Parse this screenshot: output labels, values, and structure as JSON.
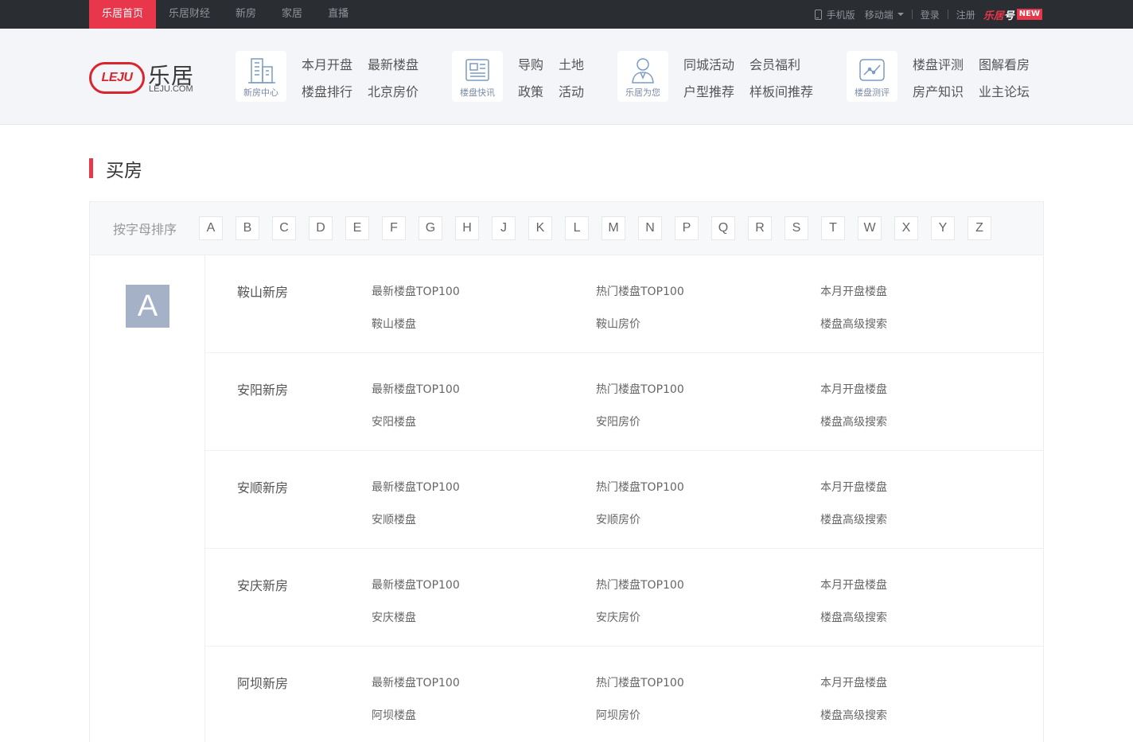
{
  "topnav": {
    "items": [
      "乐居首页",
      "乐居财经",
      "新房",
      "家居",
      "直播"
    ],
    "mobile": "手机版",
    "mobile_end": "移动端",
    "login": "登录",
    "register": "注册",
    "lejuhao_a": "乐居",
    "lejuhao_b": "号",
    "lejuhao_badge": "NEW"
  },
  "logo": {
    "badge": "LEJU",
    "cn": "乐居",
    "en": "LEJU.COM"
  },
  "nav": {
    "g1": {
      "caption": "新房中心",
      "icon": "building-icon",
      "links": [
        "本月开盘",
        "楼盘排行",
        "最新楼盘",
        "北京房价"
      ]
    },
    "g2": {
      "caption": "楼盘快讯",
      "icon": "newspaper-icon",
      "links": [
        "导购",
        "政策",
        "土地",
        "活动"
      ]
    },
    "g3": {
      "caption": "乐居为您",
      "icon": "agent-icon",
      "links": [
        "同城活动",
        "户型推荐",
        "会员福利",
        "样板间推荐"
      ]
    },
    "g4": {
      "caption": "楼盘测评",
      "icon": "chart-icon",
      "links": [
        "楼盘评测",
        "房产知识",
        "图解看房",
        "业主论坛"
      ]
    }
  },
  "section_title": "买房",
  "letters": {
    "label": "按字母排序",
    "items": [
      "A",
      "B",
      "C",
      "D",
      "E",
      "F",
      "G",
      "H",
      "J",
      "K",
      "L",
      "M",
      "N",
      "P",
      "Q",
      "R",
      "S",
      "T",
      "W",
      "X",
      "Y",
      "Z"
    ]
  },
  "current_letter": "A",
  "cities": [
    {
      "name": "鞍山新房",
      "l1": "最新楼盘TOP100",
      "l2": "热门楼盘TOP100",
      "l3": "本月开盘楼盘",
      "l4": "鞍山楼盘",
      "l5": "鞍山房价",
      "l6": "楼盘高级搜索"
    },
    {
      "name": "安阳新房",
      "l1": "最新楼盘TOP100",
      "l2": "热门楼盘TOP100",
      "l3": "本月开盘楼盘",
      "l4": "安阳楼盘",
      "l5": "安阳房价",
      "l6": "楼盘高级搜索"
    },
    {
      "name": "安顺新房",
      "l1": "最新楼盘TOP100",
      "l2": "热门楼盘TOP100",
      "l3": "本月开盘楼盘",
      "l4": "安顺楼盘",
      "l5": "安顺房价",
      "l6": "楼盘高级搜索"
    },
    {
      "name": "安庆新房",
      "l1": "最新楼盘TOP100",
      "l2": "热门楼盘TOP100",
      "l3": "本月开盘楼盘",
      "l4": "安庆楼盘",
      "l5": "安庆房价",
      "l6": "楼盘高级搜索"
    },
    {
      "name": "阿坝新房",
      "l1": "最新楼盘TOP100",
      "l2": "热门楼盘TOP100",
      "l3": "本月开盘楼盘",
      "l4": "阿坝楼盘",
      "l5": "阿坝房价",
      "l6": "楼盘高级搜索"
    }
  ],
  "colors": {
    "accent": "#e8364a",
    "topbar": "#2a2d31",
    "letter_badge": "#a5b1c7"
  }
}
